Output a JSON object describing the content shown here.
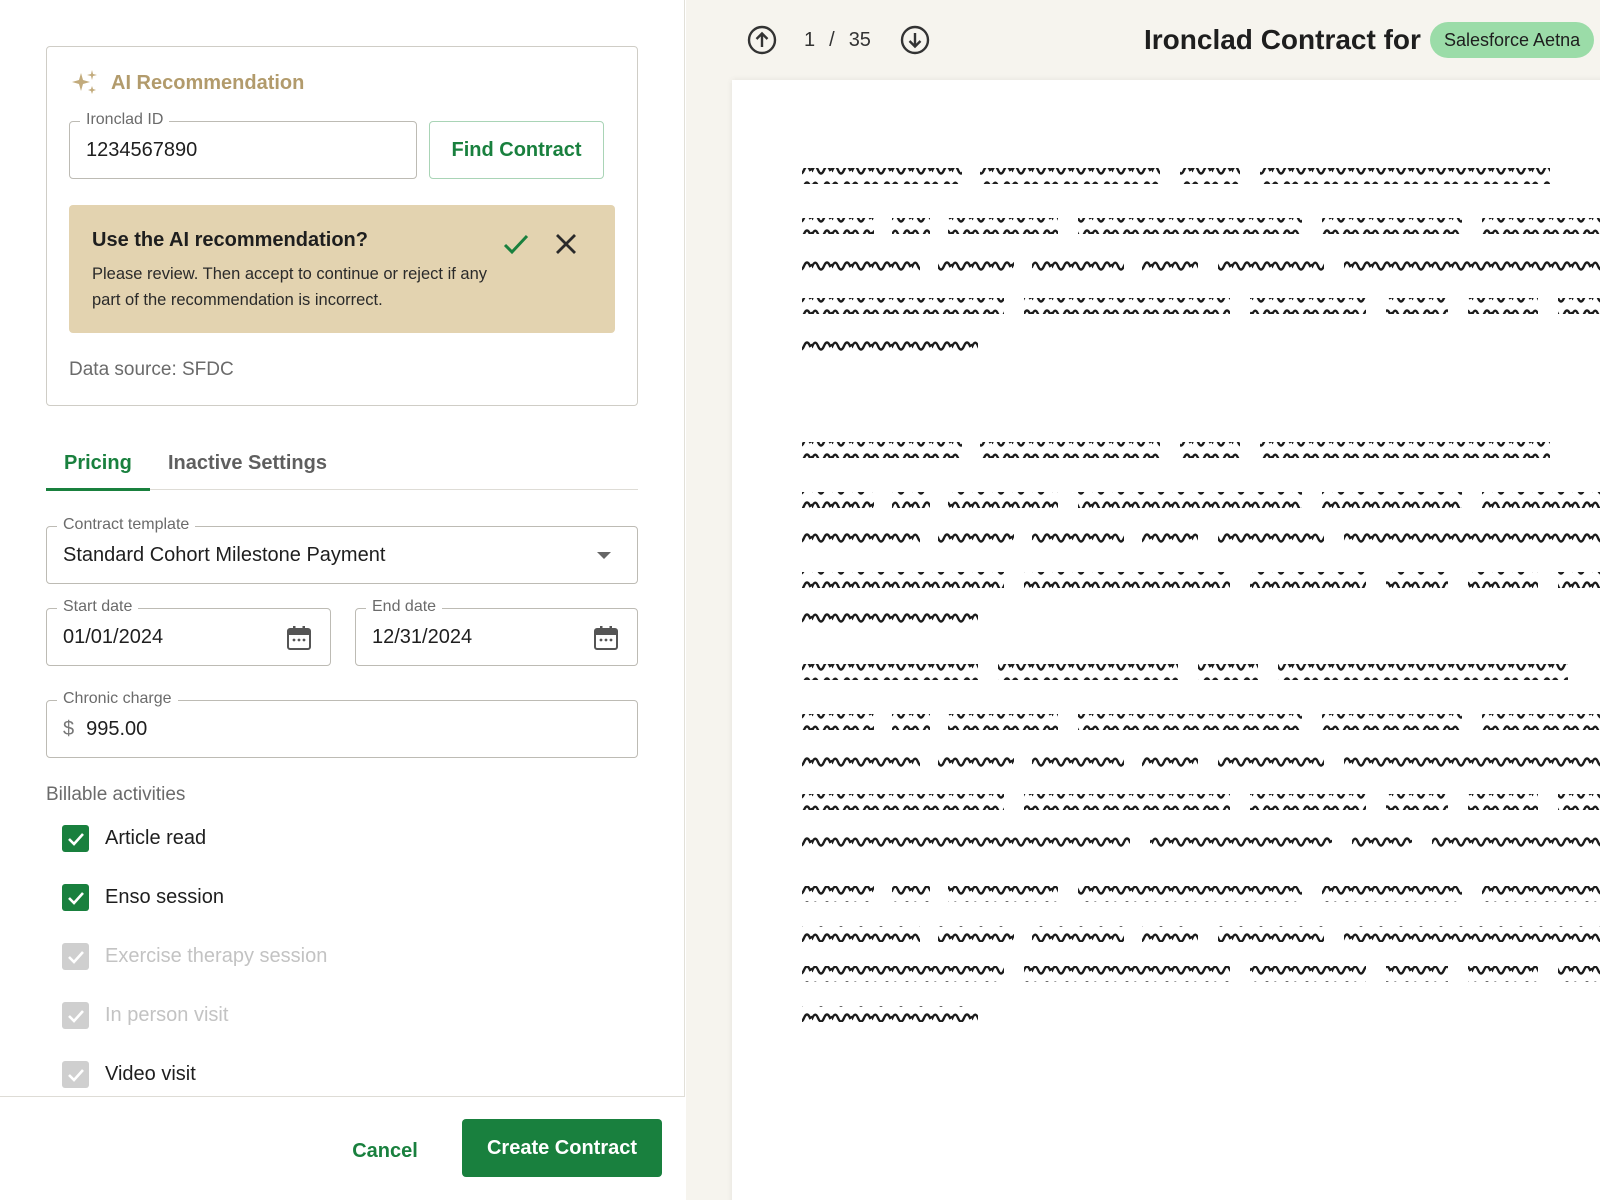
{
  "ai_card": {
    "title": "AI Recommendation",
    "ironclad_label": "Ironclad ID",
    "ironclad_value": "1234567890",
    "find_button": "Find Contract",
    "banner_title": "Use the AI recommendation?",
    "banner_desc": "Please review. Then accept to continue or reject if any part of the recommendation is incorrect.",
    "data_source": "Data source: SFDC"
  },
  "tabs": [
    {
      "label": "Pricing",
      "active": true
    },
    {
      "label": "Inactive Settings",
      "active": false
    }
  ],
  "form": {
    "template_label": "Contract template",
    "template_value": "Standard Cohort Milestone Payment",
    "start_label": "Start date",
    "start_value": "01/01/2024",
    "end_label": "End date",
    "end_value": "12/31/2024",
    "charge_label": "Chronic charge",
    "currency": "$",
    "charge_value": "995.00"
  },
  "billable": {
    "label": "Billable activities",
    "items": [
      {
        "label": "Article read",
        "checked": true,
        "disabled": false
      },
      {
        "label": "Enso session",
        "checked": true,
        "disabled": false
      },
      {
        "label": "Exercise therapy session",
        "checked": true,
        "disabled": true
      },
      {
        "label": "In person visit",
        "checked": true,
        "disabled": true
      },
      {
        "label": "Video visit",
        "checked": true,
        "disabled": true
      }
    ]
  },
  "footer": {
    "cancel": "Cancel",
    "create": "Create Contract"
  },
  "viewer": {
    "page_current": "1",
    "page_separator": "/",
    "page_total": "35",
    "title": "Ironclad Contract for",
    "pill": "Salesforce Aetna"
  },
  "colors": {
    "brand_green": "#19803e",
    "banner_bg": "#e3d3b0",
    "pill_bg": "#9bdca8",
    "ai_gold": "#b29b6c"
  }
}
